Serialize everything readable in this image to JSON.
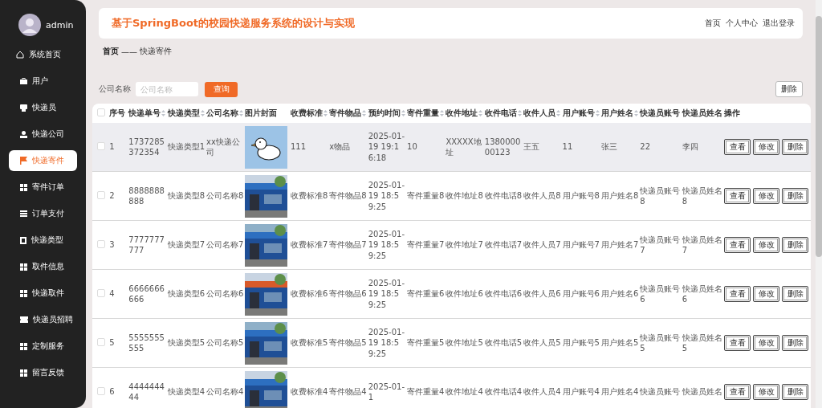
{
  "sidebar": {
    "user": "admin",
    "items": [
      {
        "label": "系统首页",
        "kind": "home",
        "selected": false
      },
      {
        "label": "用户",
        "kind": "menu",
        "selected": false
      },
      {
        "label": "快递员",
        "kind": "menu",
        "selected": false
      },
      {
        "label": "快递公司",
        "kind": "menu",
        "selected": false
      },
      {
        "label": "快递寄件",
        "kind": "menu",
        "selected": true
      },
      {
        "label": "寄件订单",
        "kind": "menu",
        "selected": false
      },
      {
        "label": "订单支付",
        "kind": "menu",
        "selected": false
      },
      {
        "label": "快递类型",
        "kind": "menu",
        "selected": false
      },
      {
        "label": "取件信息",
        "kind": "menu",
        "selected": false
      },
      {
        "label": "快递取件",
        "kind": "menu",
        "selected": false
      },
      {
        "label": "快递员招聘",
        "kind": "menu",
        "selected": false
      },
      {
        "label": "定制服务",
        "kind": "menu",
        "selected": false
      },
      {
        "label": "留言反馈",
        "kind": "menu",
        "selected": false
      }
    ]
  },
  "header": {
    "title": "基于SpringBoot的校园快递服务系统的设计与实现",
    "links": [
      "首页",
      "个人中心",
      "退出登录"
    ]
  },
  "breadcrumb": {
    "home": "首页",
    "separator": "——",
    "current": "快递寄件"
  },
  "search": {
    "label": "公司名称",
    "placeholder": "公司名称",
    "button": "查询",
    "delete_button": "删除"
  },
  "table": {
    "header_checked": false,
    "columns": [
      {
        "label": "序号",
        "kind": "text",
        "sortable": false
      },
      {
        "label": "快递单号",
        "kind": "text",
        "sortable": true
      },
      {
        "label": "快递类型",
        "kind": "text",
        "sortable": true
      },
      {
        "label": "公司名称",
        "kind": "text",
        "sortable": true
      },
      {
        "label": "图片封面",
        "kind": "picture",
        "sortable": false
      },
      {
        "label": "收费标准",
        "kind": "text",
        "sortable": true
      },
      {
        "label": "寄件物品",
        "kind": "text",
        "sortable": true
      },
      {
        "label": "预约时间",
        "kind": "text",
        "sortable": true
      },
      {
        "label": "寄件重量",
        "kind": "text",
        "sortable": true
      },
      {
        "label": "收件地址",
        "kind": "text",
        "sortable": true
      },
      {
        "label": "收件电话",
        "kind": "text",
        "sortable": true
      },
      {
        "label": "收件人员",
        "kind": "text",
        "sortable": true
      },
      {
        "label": "用户账号",
        "kind": "text",
        "sortable": true
      },
      {
        "label": "用户姓名",
        "kind": "text",
        "sortable": true
      },
      {
        "label": "快递员账号",
        "kind": "text",
        "sortable": false
      },
      {
        "label": "快递员姓名",
        "kind": "text",
        "sortable": false
      },
      {
        "label": "操作",
        "kind": "actions",
        "sortable": false
      }
    ],
    "rows": [
      {
        "checked": false,
        "highlighted": true,
        "cells": [
          "1",
          "1737285372354",
          "快递类型1",
          "xx快递公司",
          {
            "kind": "picture"
          },
          "111",
          "x物品",
          "2025-01-19 19:16:18",
          "10",
          "XXXXX地址",
          "138000000123",
          "王五",
          "11",
          "张三",
          "22",
          "李四"
        ],
        "actions": [
          "查看",
          "修改",
          "删除"
        ]
      },
      {
        "checked": false,
        "highlighted": false,
        "cells": [
          "2",
          "8888888888",
          "快递类型8",
          "公司名称8",
          {
            "kind": "picture"
          },
          "收费标准8",
          "寄件物品8",
          "2025-01-19 18:59:25",
          "寄件重量8",
          "收件地址8",
          "收件电话8",
          "收件人员8",
          "用户账号8",
          "用户姓名8",
          "快递员账号8",
          "快递员姓名8"
        ],
        "actions": [
          "查看",
          "修改",
          "删除"
        ]
      },
      {
        "checked": false,
        "highlighted": false,
        "cells": [
          "3",
          "7777777777",
          "快递类型7",
          "公司名称7",
          {
            "kind": "picture"
          },
          "收费标准7",
          "寄件物品7",
          "2025-01-19 18:59:25",
          "寄件重量7",
          "收件地址7",
          "收件电话7",
          "收件人员7",
          "用户账号7",
          "用户姓名7",
          "快递员账号7",
          "快递员姓名7"
        ],
        "actions": [
          "查看",
          "修改",
          "删除"
        ]
      },
      {
        "checked": false,
        "highlighted": false,
        "cells": [
          "4",
          "6666666666",
          "快递类型6",
          "公司名称6",
          {
            "kind": "picture"
          },
          "收费标准6",
          "寄件物品6",
          "2025-01-19 18:59:25",
          "寄件重量6",
          "收件地址6",
          "收件电话6",
          "收件人员6",
          "用户账号6",
          "用户姓名6",
          "快递员账号6",
          "快递员姓名6"
        ],
        "actions": [
          "查看",
          "修改",
          "删除"
        ]
      },
      {
        "checked": false,
        "highlighted": false,
        "cells": [
          "5",
          "5555555555",
          "快递类型5",
          "公司名称5",
          {
            "kind": "picture"
          },
          "收费标准5",
          "寄件物品5",
          "2025-01-19 18:59:25",
          "寄件重量5",
          "收件地址5",
          "收件电话5",
          "收件人员5",
          "用户账号5",
          "用户姓名5",
          "快递员账号5",
          "快递员姓名5"
        ],
        "actions": [
          "查看",
          "修改",
          "删除"
        ]
      },
      {
        "checked": false,
        "highlighted": false,
        "cells": [
          "6",
          "444444444",
          "快递类型4",
          "公司名称4",
          {
            "kind": "picture"
          },
          "收费标准4",
          "寄件物品4",
          "2025-01-1",
          "寄件重量4",
          "收件地址4",
          "收件电话4",
          "收件人员4",
          "用户账号4",
          "用户姓名4",
          "快递员账号",
          "快递员姓名"
        ],
        "actions": [
          "查看",
          "修改",
          "删除"
        ]
      }
    ]
  }
}
